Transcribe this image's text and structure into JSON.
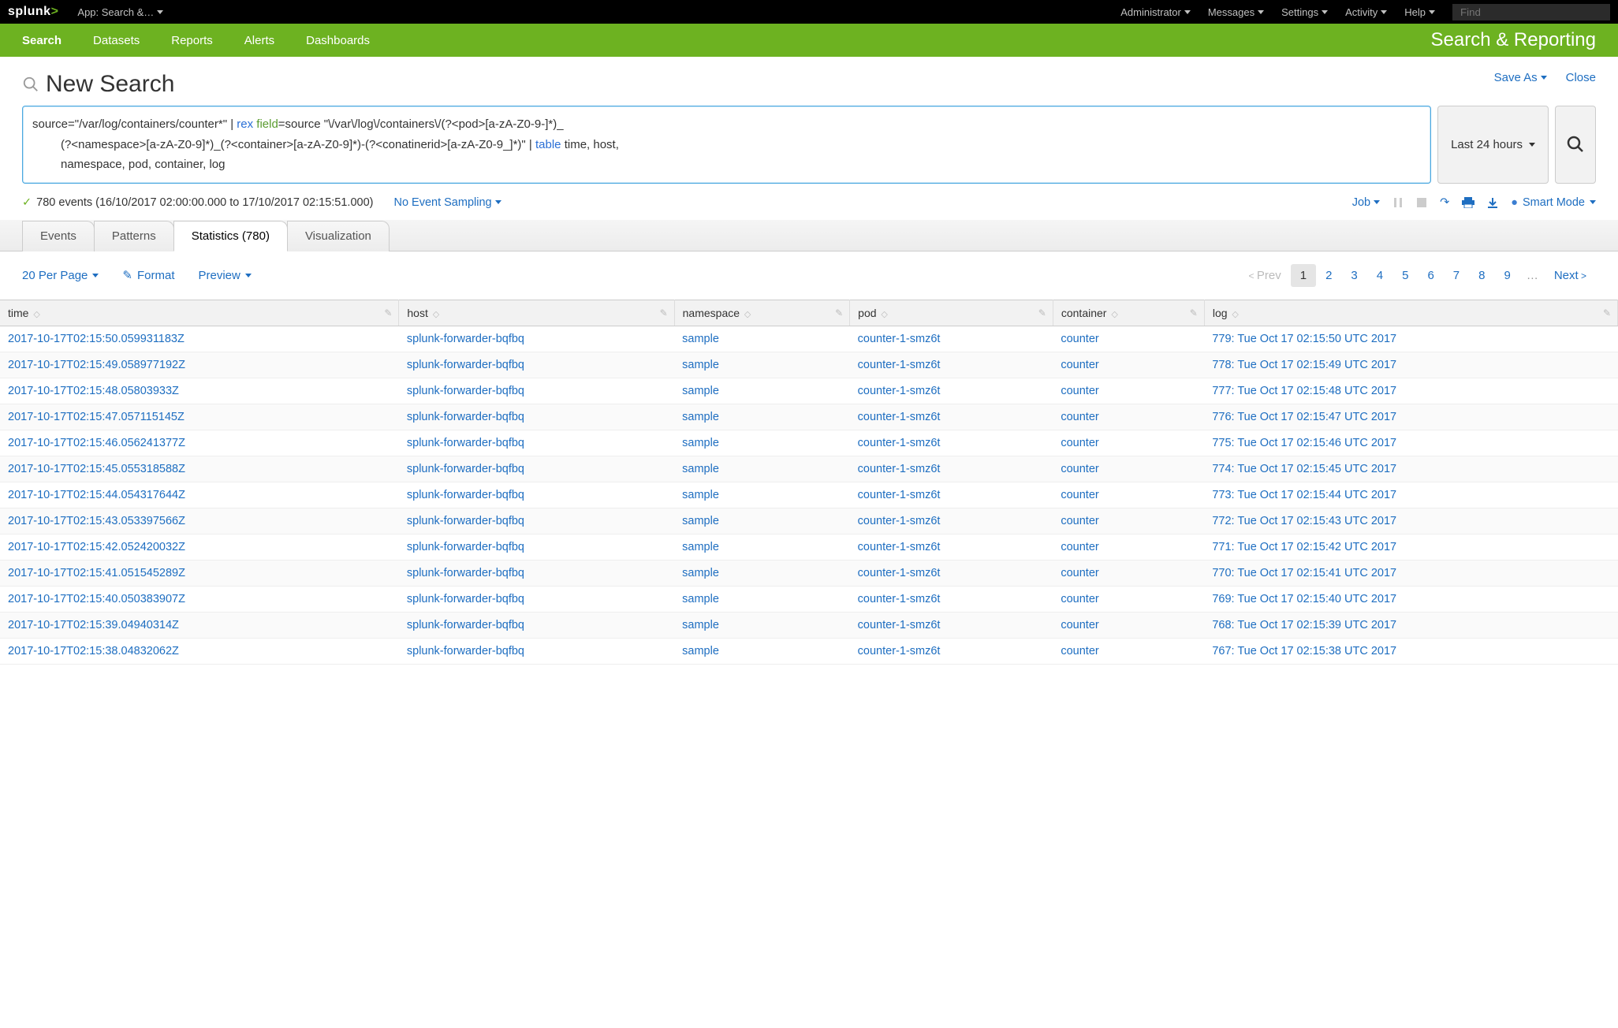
{
  "topbar": {
    "app_label": "App: Search &…",
    "items": [
      "Administrator",
      "Messages",
      "Settings",
      "Activity",
      "Help"
    ],
    "find_placeholder": "Find"
  },
  "greenbar": {
    "items": [
      "Search",
      "Datasets",
      "Reports",
      "Alerts",
      "Dashboards"
    ],
    "appname": "Search & Reporting"
  },
  "header": {
    "title": "New Search",
    "save_as": "Save As",
    "close": "Close"
  },
  "search": {
    "query_part1": "source=\"/var/log/containers/counter*\"  | ",
    "query_rex": "rex",
    "query_field": " field",
    "query_part2": "=source \"\\/var\\/log\\/containers\\/(?<pod>[a-zA-Z0-9-]*)_",
    "query_line2a": "(?<namespace>[a-zA-Z0-9]*)_(?<container>[a-zA-Z0-9]*)-(?<conatinerid>[a-zA-Z0-9_]*)\" | ",
    "query_table": "table",
    "query_line2b": " time, host,",
    "query_line3": "namespace, pod, container, log",
    "timerange": "Last 24 hours"
  },
  "status": {
    "events": "780 events (16/10/2017 02:00:00.000 to 17/10/2017 02:15:51.000)",
    "sampling": "No Event Sampling",
    "job": "Job",
    "smart": "Smart Mode"
  },
  "tabs": {
    "events": "Events",
    "patterns": "Patterns",
    "statistics": "Statistics (780)",
    "visualization": "Visualization"
  },
  "toolrow": {
    "per_page": "20 Per Page",
    "format": "Format",
    "preview": "Preview"
  },
  "pager": {
    "prev": "Prev",
    "pages": [
      "1",
      "2",
      "3",
      "4",
      "5",
      "6",
      "7",
      "8",
      "9"
    ],
    "ellipsis": "…",
    "next": "Next"
  },
  "columns": [
    "time",
    "host",
    "namespace",
    "pod",
    "container",
    "log"
  ],
  "rows": [
    {
      "time": "2017-10-17T02:15:50.059931183Z",
      "host": "splunk-forwarder-bqfbq",
      "namespace": "sample",
      "pod": "counter-1-smz6t",
      "container": "counter",
      "log": "779: Tue Oct 17 02:15:50 UTC 2017"
    },
    {
      "time": "2017-10-17T02:15:49.058977192Z",
      "host": "splunk-forwarder-bqfbq",
      "namespace": "sample",
      "pod": "counter-1-smz6t",
      "container": "counter",
      "log": "778: Tue Oct 17 02:15:49 UTC 2017"
    },
    {
      "time": "2017-10-17T02:15:48.05803933Z",
      "host": "splunk-forwarder-bqfbq",
      "namespace": "sample",
      "pod": "counter-1-smz6t",
      "container": "counter",
      "log": "777: Tue Oct 17 02:15:48 UTC 2017"
    },
    {
      "time": "2017-10-17T02:15:47.057115145Z",
      "host": "splunk-forwarder-bqfbq",
      "namespace": "sample",
      "pod": "counter-1-smz6t",
      "container": "counter",
      "log": "776: Tue Oct 17 02:15:47 UTC 2017"
    },
    {
      "time": "2017-10-17T02:15:46.056241377Z",
      "host": "splunk-forwarder-bqfbq",
      "namespace": "sample",
      "pod": "counter-1-smz6t",
      "container": "counter",
      "log": "775: Tue Oct 17 02:15:46 UTC 2017"
    },
    {
      "time": "2017-10-17T02:15:45.055318588Z",
      "host": "splunk-forwarder-bqfbq",
      "namespace": "sample",
      "pod": "counter-1-smz6t",
      "container": "counter",
      "log": "774: Tue Oct 17 02:15:45 UTC 2017"
    },
    {
      "time": "2017-10-17T02:15:44.054317644Z",
      "host": "splunk-forwarder-bqfbq",
      "namespace": "sample",
      "pod": "counter-1-smz6t",
      "container": "counter",
      "log": "773: Tue Oct 17 02:15:44 UTC 2017"
    },
    {
      "time": "2017-10-17T02:15:43.053397566Z",
      "host": "splunk-forwarder-bqfbq",
      "namespace": "sample",
      "pod": "counter-1-smz6t",
      "container": "counter",
      "log": "772: Tue Oct 17 02:15:43 UTC 2017"
    },
    {
      "time": "2017-10-17T02:15:42.052420032Z",
      "host": "splunk-forwarder-bqfbq",
      "namespace": "sample",
      "pod": "counter-1-smz6t",
      "container": "counter",
      "log": "771: Tue Oct 17 02:15:42 UTC 2017"
    },
    {
      "time": "2017-10-17T02:15:41.051545289Z",
      "host": "splunk-forwarder-bqfbq",
      "namespace": "sample",
      "pod": "counter-1-smz6t",
      "container": "counter",
      "log": "770: Tue Oct 17 02:15:41 UTC 2017"
    },
    {
      "time": "2017-10-17T02:15:40.050383907Z",
      "host": "splunk-forwarder-bqfbq",
      "namespace": "sample",
      "pod": "counter-1-smz6t",
      "container": "counter",
      "log": "769: Tue Oct 17 02:15:40 UTC 2017"
    },
    {
      "time": "2017-10-17T02:15:39.04940314Z",
      "host": "splunk-forwarder-bqfbq",
      "namespace": "sample",
      "pod": "counter-1-smz6t",
      "container": "counter",
      "log": "768: Tue Oct 17 02:15:39 UTC 2017"
    },
    {
      "time": "2017-10-17T02:15:38.04832062Z",
      "host": "splunk-forwarder-bqfbq",
      "namespace": "sample",
      "pod": "counter-1-smz6t",
      "container": "counter",
      "log": "767: Tue Oct 17 02:15:38 UTC 2017"
    }
  ]
}
